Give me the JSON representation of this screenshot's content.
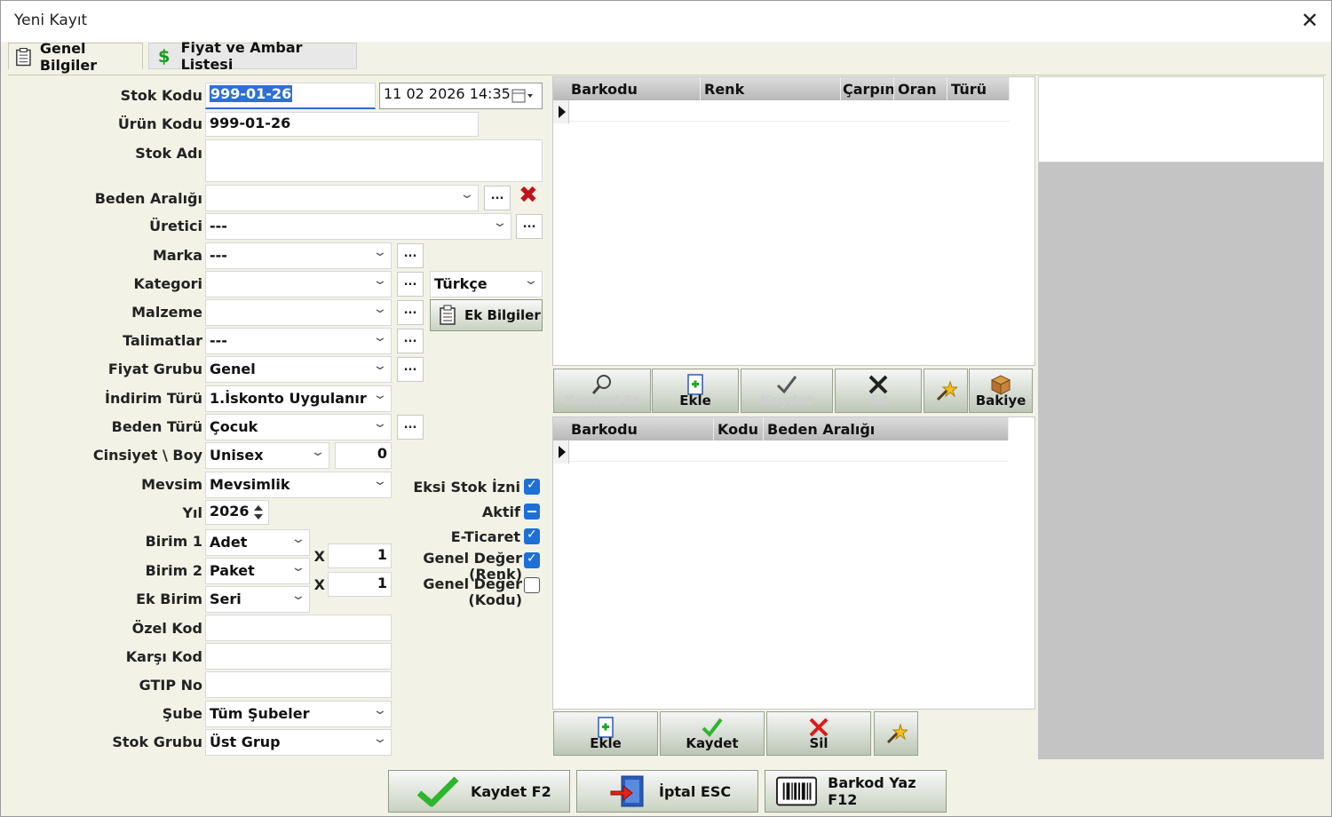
{
  "window": {
    "title": "Yeni Kayıt",
    "close_glyph": "✕"
  },
  "tabs": [
    {
      "label": "Genel Bilgiler",
      "icon": "clipboard-icon"
    },
    {
      "label": "Fiyat  ve  Ambar Listesi",
      "icon": "dollar-icon"
    }
  ],
  "form": {
    "stok_kodu": {
      "label": "Stok Kodu",
      "value": "999-01-26"
    },
    "tarih": {
      "value": "11 02 2026 14:35"
    },
    "urun_kodu": {
      "label": "Ürün Kodu",
      "value": "999-01-26"
    },
    "stok_adi": {
      "label": "Stok Adı",
      "value": ""
    },
    "beden_araligi": {
      "label": "Beden Aralığı",
      "value": ""
    },
    "uretici": {
      "label": "Üretici",
      "value": "---"
    },
    "marka": {
      "label": "Marka",
      "value": "---"
    },
    "kategori": {
      "label": "Kategori",
      "value": ""
    },
    "dil": {
      "value": "Türkçe"
    },
    "malzeme": {
      "label": "Malzeme",
      "value": ""
    },
    "ek_bilgiler": {
      "label": "Ek Bilgiler"
    },
    "talimatlar": {
      "label": "Talimatlar",
      "value": "---"
    },
    "fiyat_grubu": {
      "label": "Fiyat Grubu",
      "value": "Genel"
    },
    "indirim_turu": {
      "label": "İndirim Türü",
      "value": "1.İskonto Uygulanır"
    },
    "beden_turu": {
      "label": "Beden Türü",
      "value": "Çocuk"
    },
    "cinsiyet_boy": {
      "label": "Cinsiyet \\ Boy",
      "value": "Unisex",
      "boy": "0"
    },
    "mevsim": {
      "label": "Mevsim",
      "value": "Mevsimlik"
    },
    "yil": {
      "label": "Yıl",
      "value": "2026"
    },
    "birim1": {
      "label": "Birim 1",
      "value": "Adet"
    },
    "birim2": {
      "label": "Birim 2",
      "value": "Paket",
      "x": "X",
      "carpan": "1"
    },
    "ek_birim": {
      "label": "Ek Birim",
      "value": "Seri",
      "x": "X",
      "carpan": "1"
    },
    "ozel_kod": {
      "label": "Özel Kod",
      "value": ""
    },
    "karsi_kod": {
      "label": "Karşı Kod",
      "value": ""
    },
    "gtip_no": {
      "label": "GTIP No",
      "value": ""
    },
    "sube": {
      "label": "Şube",
      "value": "Tüm Şubeler"
    },
    "stok_grubu": {
      "label": "Stok Grubu",
      "value": "Üst Grup"
    },
    "dots_label": "..."
  },
  "checkboxes": [
    {
      "label": "Eksi Stok İzni",
      "state": "checked"
    },
    {
      "label": "Aktif",
      "state": "indeterminate"
    },
    {
      "label": "E-Ticaret",
      "state": "checked"
    },
    {
      "label": "Genel Değer (Renk)",
      "state": "checked"
    },
    {
      "label": "Genel Değer (Kodu)",
      "state": "unchecked"
    }
  ],
  "barcode_grid": {
    "columns": [
      "Barkodu",
      "Renk",
      "Çarpın",
      "Oran",
      "Türü"
    ]
  },
  "mid_toolbar": [
    {
      "label": "Kontrol Et",
      "icon": "magnifier-icon",
      "enabled": false
    },
    {
      "label": "Ekle",
      "icon": "add-document-icon",
      "enabled": true
    },
    {
      "label": "Kaydet",
      "icon": "check-icon",
      "enabled": false
    },
    {
      "label": "Sil",
      "icon": "delete-icon",
      "enabled": false
    },
    {
      "label": "",
      "icon": "magic-wand-icon",
      "enabled": true
    },
    {
      "label": "Bakiye",
      "icon": "box-icon",
      "enabled": true
    }
  ],
  "size_grid": {
    "columns": [
      "Barkodu",
      "Kodu",
      "Beden Aralığı"
    ]
  },
  "bottom_toolbar": [
    {
      "label": "Ekle",
      "icon": "add-document-icon"
    },
    {
      "label": "Kaydet",
      "icon": "check-icon"
    },
    {
      "label": "Sil",
      "icon": "delete-icon"
    },
    {
      "label": "",
      "icon": "magic-wand-icon"
    }
  ],
  "footer": {
    "kaydet": "Kaydet F2",
    "iptal": "İptal ESC",
    "barkod": "Barkod Yaz F12"
  },
  "colors": {
    "panel_bg": "#f2f3e6",
    "accent_blue": "#1e6fd6",
    "delete_red": "#c0141c",
    "ok_green": "#2db52d"
  }
}
